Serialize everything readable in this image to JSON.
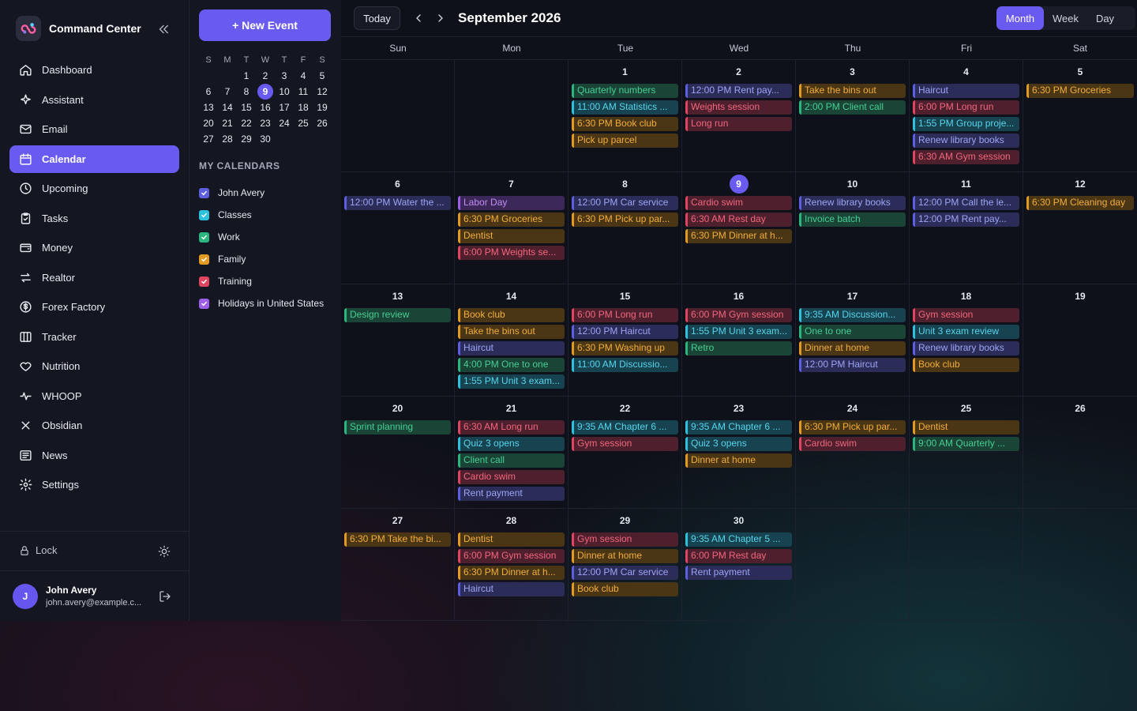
{
  "app": {
    "name": "Command Center"
  },
  "nav": [
    {
      "label": "Dashboard",
      "icon": "home-icon"
    },
    {
      "label": "Assistant",
      "icon": "sparkle-icon"
    },
    {
      "label": "Email",
      "icon": "mail-icon"
    },
    {
      "label": "Calendar",
      "icon": "calendar-icon",
      "active": true
    },
    {
      "label": "Upcoming",
      "icon": "clock-icon"
    },
    {
      "label": "Tasks",
      "icon": "clipboard-icon"
    },
    {
      "label": "Money",
      "icon": "wallet-icon"
    },
    {
      "label": "Realtor",
      "icon": "swap-arrows-icon"
    },
    {
      "label": "Forex Factory",
      "icon": "dollar-circle-icon"
    },
    {
      "label": "Tracker",
      "icon": "columns-icon"
    },
    {
      "label": "Nutrition",
      "icon": "heart-icon"
    },
    {
      "label": "WHOOP",
      "icon": "activity-icon"
    },
    {
      "label": "Obsidian",
      "icon": "x-icon"
    },
    {
      "label": "News",
      "icon": "newspaper-icon"
    },
    {
      "label": "Settings",
      "icon": "gear-icon"
    }
  ],
  "footer": {
    "lock_label": "Lock",
    "user_initial": "J",
    "user_name": "John Avery",
    "user_email": "john.avery@example.c..."
  },
  "new_event_label": "+ New Event",
  "mini_calendar": {
    "day_headers": [
      "S",
      "M",
      "T",
      "W",
      "T",
      "F",
      "S"
    ],
    "weeks": [
      [
        "",
        "",
        "1",
        "2",
        "3",
        "4",
        "5"
      ],
      [
        "6",
        "7",
        "8",
        "9",
        "10",
        "11",
        "12"
      ],
      [
        "13",
        "14",
        "15",
        "16",
        "17",
        "18",
        "19"
      ],
      [
        "20",
        "21",
        "22",
        "23",
        "24",
        "25",
        "26"
      ],
      [
        "27",
        "28",
        "29",
        "30",
        "",
        "",
        ""
      ]
    ],
    "today": "9"
  },
  "my_calendars_title": "MY CALENDARS",
  "calendars": [
    {
      "name": "John Avery",
      "key": "John",
      "color": "#5d5ee0"
    },
    {
      "name": "Classes",
      "key": "Classes",
      "color": "#2ec1dc"
    },
    {
      "name": "Work",
      "key": "Work",
      "color": "#2bb680"
    },
    {
      "name": "Family",
      "key": "Family",
      "color": "#e39a20"
    },
    {
      "name": "Training",
      "key": "Training",
      "color": "#e0445f"
    },
    {
      "name": "Holidays in United States",
      "key": "Holidays",
      "color": "#9d5ee8"
    }
  ],
  "toolbar": {
    "today_label": "Today",
    "month_title": "September 2026",
    "views": [
      "Month",
      "Week",
      "Day"
    ],
    "active_view": "Month"
  },
  "weekdays": [
    "Sun",
    "Mon",
    "Tue",
    "Wed",
    "Thu",
    "Fri",
    "Sat"
  ],
  "today_day": "9",
  "cells": [
    {
      "day": "",
      "events": []
    },
    {
      "day": "",
      "events": []
    },
    {
      "day": "1",
      "events": [
        {
          "t": "Quarterly numbers",
          "c": "Work"
        },
        {
          "t": "11:00 AM Statistics ...",
          "c": "Classes"
        },
        {
          "t": "6:30 PM Book club",
          "c": "Family"
        },
        {
          "t": "Pick up parcel",
          "c": "Family"
        }
      ]
    },
    {
      "day": "2",
      "events": [
        {
          "t": "12:00 PM Rent pay...",
          "c": "John"
        },
        {
          "t": "Weights session",
          "c": "Training"
        },
        {
          "t": "Long run",
          "c": "Training"
        }
      ]
    },
    {
      "day": "3",
      "events": [
        {
          "t": "Take the bins out",
          "c": "Family"
        },
        {
          "t": "2:00 PM Client call",
          "c": "Work"
        }
      ]
    },
    {
      "day": "4",
      "events": [
        {
          "t": "Haircut",
          "c": "John"
        },
        {
          "t": "6:00 PM Long run",
          "c": "Training"
        },
        {
          "t": "1:55 PM Group proje...",
          "c": "Classes"
        },
        {
          "t": "Renew library books",
          "c": "John"
        },
        {
          "t": "6:30 AM Gym session",
          "c": "Training"
        }
      ]
    },
    {
      "day": "5",
      "events": [
        {
          "t": "6:30 PM Groceries",
          "c": "Family"
        }
      ]
    },
    {
      "day": "6",
      "events": [
        {
          "t": "12:00 PM Water the ...",
          "c": "John"
        }
      ]
    },
    {
      "day": "7",
      "events": [
        {
          "t": "Labor Day",
          "c": "Holidays"
        },
        {
          "t": "6:30 PM Groceries",
          "c": "Family"
        },
        {
          "t": "Dentist",
          "c": "Family"
        },
        {
          "t": "6:00 PM Weights se...",
          "c": "Training"
        }
      ]
    },
    {
      "day": "8",
      "events": [
        {
          "t": "12:00 PM Car service",
          "c": "John"
        },
        {
          "t": "6:30 PM Pick up par...",
          "c": "Family"
        }
      ]
    },
    {
      "day": "9",
      "events": [
        {
          "t": "Cardio swim",
          "c": "Training"
        },
        {
          "t": "6:30 AM Rest day",
          "c": "Training"
        },
        {
          "t": "6:30 PM Dinner at h...",
          "c": "Family"
        }
      ]
    },
    {
      "day": "10",
      "events": [
        {
          "t": "Renew library books",
          "c": "John"
        },
        {
          "t": "Invoice batch",
          "c": "Work"
        }
      ]
    },
    {
      "day": "11",
      "events": [
        {
          "t": "12:00 PM Call the le...",
          "c": "John"
        },
        {
          "t": "12:00 PM Rent pay...",
          "c": "John"
        }
      ]
    },
    {
      "day": "12",
      "events": [
        {
          "t": "6:30 PM Cleaning day",
          "c": "Family"
        }
      ]
    },
    {
      "day": "13",
      "events": [
        {
          "t": "Design review",
          "c": "Work"
        }
      ]
    },
    {
      "day": "14",
      "events": [
        {
          "t": "Book club",
          "c": "Family"
        },
        {
          "t": "Take the bins out",
          "c": "Family"
        },
        {
          "t": "Haircut",
          "c": "John"
        },
        {
          "t": "4:00 PM One to one",
          "c": "Work"
        },
        {
          "t": "1:55 PM Unit 3 exam...",
          "c": "Classes"
        }
      ]
    },
    {
      "day": "15",
      "events": [
        {
          "t": "6:00 PM Long run",
          "c": "Training"
        },
        {
          "t": "12:00 PM Haircut",
          "c": "John"
        },
        {
          "t": "6:30 PM Washing up",
          "c": "Family"
        },
        {
          "t": "11:00 AM Discussio...",
          "c": "Classes"
        }
      ]
    },
    {
      "day": "16",
      "events": [
        {
          "t": "6:00 PM Gym session",
          "c": "Training"
        },
        {
          "t": "1:55 PM Unit 3 exam...",
          "c": "Classes"
        },
        {
          "t": "Retro",
          "c": "Work"
        }
      ]
    },
    {
      "day": "17",
      "events": [
        {
          "t": "9:35 AM Discussion...",
          "c": "Classes"
        },
        {
          "t": "One to one",
          "c": "Work"
        },
        {
          "t": "Dinner at home",
          "c": "Family"
        },
        {
          "t": "12:00 PM Haircut",
          "c": "John"
        }
      ]
    },
    {
      "day": "18",
      "events": [
        {
          "t": "Gym session",
          "c": "Training"
        },
        {
          "t": "Unit 3 exam review",
          "c": "Classes"
        },
        {
          "t": "Renew library books",
          "c": "John"
        },
        {
          "t": "Book club",
          "c": "Family"
        }
      ]
    },
    {
      "day": "19",
      "events": []
    },
    {
      "day": "20",
      "events": [
        {
          "t": "Sprint planning",
          "c": "Work"
        }
      ]
    },
    {
      "day": "21",
      "events": [
        {
          "t": "6:30 AM Long run",
          "c": "Training"
        },
        {
          "t": "Quiz 3 opens",
          "c": "Classes"
        },
        {
          "t": "Client call",
          "c": "Work"
        },
        {
          "t": "Cardio swim",
          "c": "Training"
        },
        {
          "t": "Rent payment",
          "c": "John"
        }
      ]
    },
    {
      "day": "22",
      "events": [
        {
          "t": "9:35 AM Chapter 6 ...",
          "c": "Classes"
        },
        {
          "t": "Gym session",
          "c": "Training"
        }
      ]
    },
    {
      "day": "23",
      "events": [
        {
          "t": "9:35 AM Chapter 6 ...",
          "c": "Classes"
        },
        {
          "t": "Quiz 3 opens",
          "c": "Classes"
        },
        {
          "t": "Dinner at home",
          "c": "Family"
        }
      ]
    },
    {
      "day": "24",
      "events": [
        {
          "t": "6:30 PM Pick up par...",
          "c": "Family"
        },
        {
          "t": "Cardio swim",
          "c": "Training"
        }
      ]
    },
    {
      "day": "25",
      "events": [
        {
          "t": "Dentist",
          "c": "Family"
        },
        {
          "t": "9:00 AM Quarterly ...",
          "c": "Work"
        }
      ]
    },
    {
      "day": "26",
      "events": []
    },
    {
      "day": "27",
      "events": [
        {
          "t": "6:30 PM Take the bi...",
          "c": "Family"
        }
      ]
    },
    {
      "day": "28",
      "events": [
        {
          "t": "Dentist",
          "c": "Family"
        },
        {
          "t": "6:00 PM Gym session",
          "c": "Training"
        },
        {
          "t": "6:30 PM Dinner at h...",
          "c": "Family"
        },
        {
          "t": "Haircut",
          "c": "John"
        }
      ]
    },
    {
      "day": "29",
      "events": [
        {
          "t": "Gym session",
          "c": "Training"
        },
        {
          "t": "Dinner at home",
          "c": "Family"
        },
        {
          "t": "12:00 PM Car service",
          "c": "John"
        },
        {
          "t": "Book club",
          "c": "Family"
        }
      ]
    },
    {
      "day": "30",
      "events": [
        {
          "t": "9:35 AM Chapter 5 ...",
          "c": "Classes"
        },
        {
          "t": "6:00 PM Rest day",
          "c": "Training"
        },
        {
          "t": "Rent payment",
          "c": "John"
        }
      ]
    },
    {
      "day": "",
      "events": []
    },
    {
      "day": "",
      "events": []
    },
    {
      "day": "",
      "events": []
    }
  ]
}
